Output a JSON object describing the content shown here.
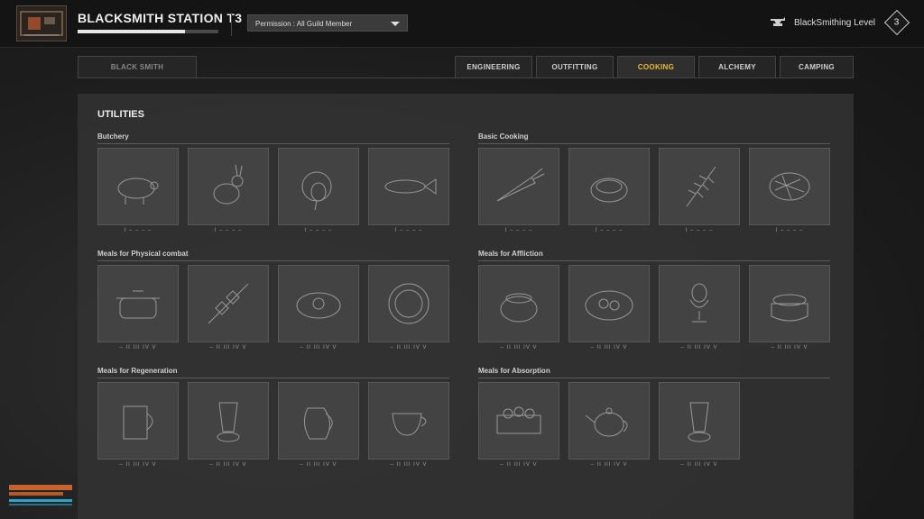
{
  "header": {
    "title": "BLACKSMITH STATION T3",
    "progress": 0.76,
    "permission": "Permission : All Guild Member",
    "level_label": "BlackSmithing Level",
    "level_value": "3"
  },
  "tabs": {
    "left": "BLACK SMITH",
    "right": [
      "ENGINEERING",
      "OUTFITTING",
      "COOKING",
      "ALCHEMY",
      "CAMPING"
    ],
    "active": "COOKING",
    "accent": "#f0b92a"
  },
  "panel": {
    "title": "UTILITIES",
    "sections": [
      {
        "label": "Butchery",
        "items": [
          {
            "icon": "pig-icon",
            "tiers": "I – – – –"
          },
          {
            "icon": "rabbit-icon",
            "tiers": "I – – – –"
          },
          {
            "icon": "turkey-icon",
            "tiers": "I – – – –"
          },
          {
            "icon": "fish-icon",
            "tiers": "I – – – –"
          }
        ]
      },
      {
        "label": "Basic Cooking",
        "items": [
          {
            "icon": "carrot-icon",
            "tiers": "I – – – –"
          },
          {
            "icon": "bread-icon",
            "tiers": "I – – – –"
          },
          {
            "icon": "herb-icon",
            "tiers": "I – – – –"
          },
          {
            "icon": "steak-icon",
            "tiers": "I – – – –"
          }
        ]
      },
      {
        "label": "Meals for Physical combat",
        "items": [
          {
            "icon": "pot-icon",
            "tiers": "– II III IV V"
          },
          {
            "icon": "skewer-icon",
            "tiers": "– II III IV V"
          },
          {
            "icon": "fried-egg-icon",
            "tiers": "– II III IV V"
          },
          {
            "icon": "plate-icon",
            "tiers": "– II III IV V"
          }
        ]
      },
      {
        "label": "Meals for Affliction",
        "items": [
          {
            "icon": "stew-pot-icon",
            "tiers": "– II III IV V"
          },
          {
            "icon": "salad-plate-icon",
            "tiers": "– II III IV V"
          },
          {
            "icon": "egg-cup-icon",
            "tiers": "– II III IV V"
          },
          {
            "icon": "casserole-icon",
            "tiers": "– II III IV V"
          }
        ]
      },
      {
        "label": "Meals for Regeneration",
        "items": [
          {
            "icon": "mug-icon",
            "tiers": "– II III IV V"
          },
          {
            "icon": "juice-glass-icon",
            "tiers": "– II III IV V"
          },
          {
            "icon": "jug-icon",
            "tiers": "– II III IV V"
          },
          {
            "icon": "teacup-icon",
            "tiers": "– II III IV V"
          }
        ]
      },
      {
        "label": "Meals for Absorption",
        "items": [
          {
            "icon": "crate-icon",
            "tiers": "– II III IV V"
          },
          {
            "icon": "teapot-icon",
            "tiers": "– II III IV V"
          },
          {
            "icon": "juice-glass-icon",
            "tiers": "– II III IV V"
          }
        ]
      }
    ]
  }
}
